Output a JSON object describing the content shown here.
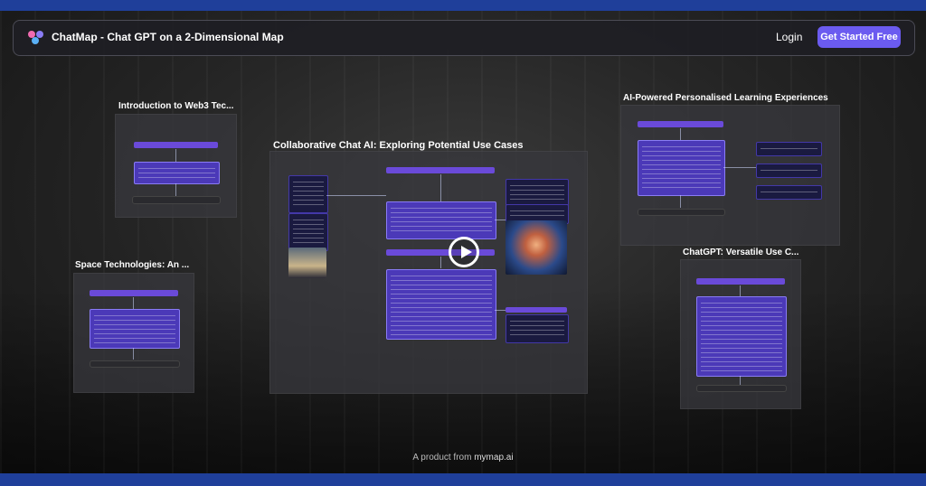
{
  "header": {
    "app_title": "ChatMap - Chat GPT on a 2-Dimensional Map",
    "login_label": "Login",
    "cta_label": "Get Started Free"
  },
  "cards": {
    "web3": "Introduction to Web3 Tec...",
    "space": "Space Technologies: An ...",
    "collab": "Collaborative Chat AI: Exploring Potential Use Cases",
    "learning": "AI-Powered Personalised Learning Experiences",
    "chatgpt": "ChatGPT: Versatile Use C..."
  },
  "footer": {
    "prefix": "A product from ",
    "brand": "mymap.ai"
  },
  "colors": {
    "accent": "#6b5bf0",
    "node_purple": "#6a4ad9",
    "page_border": "#1f3f9a"
  },
  "icons": [
    "chatmap-logo-icon",
    "play-icon"
  ]
}
